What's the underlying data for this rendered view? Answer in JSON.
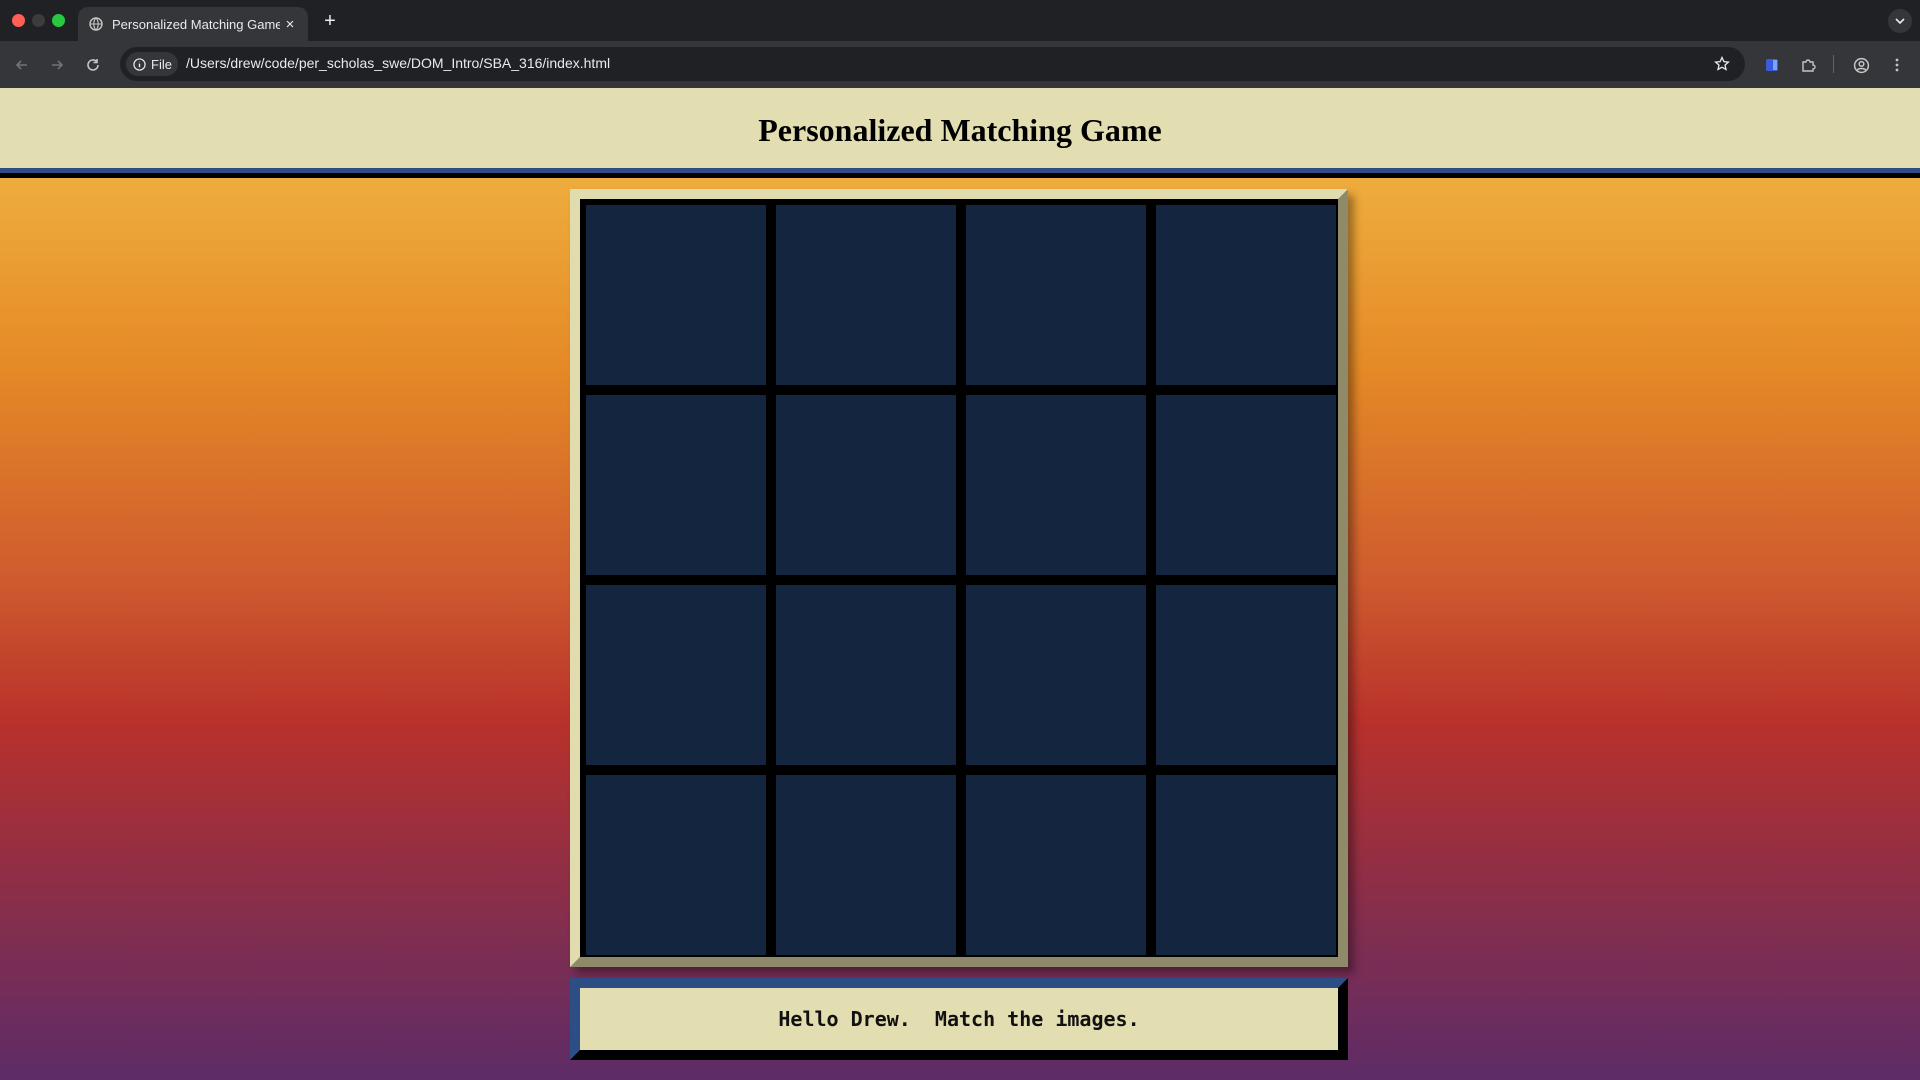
{
  "browser": {
    "tab_title": "Personalized Matching Game",
    "new_tab_label": "+",
    "close_label": "×",
    "chip_label": "File",
    "url": "/Users/drew/code/per_scholas_swe/DOM_Intro/SBA_316/index.html",
    "icons": [
      "globe-icon",
      "back-icon",
      "forward-icon",
      "reload-icon",
      "info-icon",
      "star-icon",
      "extension-icon",
      "puzzle-icon",
      "profile-icon",
      "menu-icon",
      "chevron-down-icon"
    ]
  },
  "page": {
    "title": "Personalized Matching Game",
    "message": "Hello Drew.  Match the images.",
    "card_count": 16,
    "colors": {
      "header_bg": "#e2deb1",
      "card_back": "#142540",
      "accent_blue": "#2d4e84"
    }
  }
}
